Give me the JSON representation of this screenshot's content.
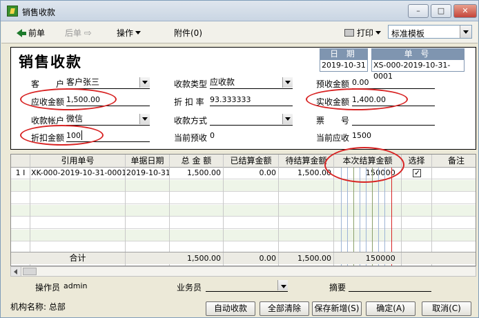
{
  "window": {
    "title": "销售收款"
  },
  "toolbar": {
    "prev": "前单",
    "next": "后单",
    "ops": "操作",
    "attach": "附件(0)",
    "print": "打印",
    "template_value": "标准模板"
  },
  "form": {
    "title": "销售收款",
    "date_label": "日 期",
    "date_value": "2019-10-31",
    "no_label": "单 号",
    "no_value": "XS-000-2019-10-31-0001",
    "customer_label": "客　　户",
    "customer_value": "客户张三",
    "receivable_label": "应收金额",
    "receivable_value": "1,500.00",
    "account_label": "收款帐户",
    "account_value": "微信",
    "discount_amt_label": "折扣金额",
    "discount_amt_value": "100",
    "collect_type_label": "收款类型",
    "collect_type_value": "应收款",
    "discount_rate_label": "折 扣 率",
    "discount_rate_value": "93.333333",
    "collect_method_label": "收款方式",
    "collect_method_value": "",
    "cur_prepaid_label": "当前预收",
    "cur_prepaid_value": "0",
    "prepaid_label": "预收金额",
    "prepaid_value": "0.00",
    "actual_label": "实收金额",
    "actual_value": "1,400.00",
    "ticket_label": "票　　号",
    "ticket_value": "",
    "cur_receivable_label": "当前应收",
    "cur_receivable_value": "1500"
  },
  "grid": {
    "columns": [
      "引用单号",
      "单据日期",
      "总 金 额",
      "已结算金额",
      "待结算金额",
      "本次结算金额",
      "选择",
      "备注"
    ],
    "rows": [
      {
        "idx": "1",
        "marker": "I",
        "ref": "XK-000-2019-10-31-0001",
        "date": "2019-10-31",
        "total": "1,500.00",
        "settled": "0.00",
        "pending": "1,500.00",
        "this_time": "150000",
        "checked": true,
        "remark": ""
      }
    ],
    "total_label": "合计",
    "total_total": "1,500.00",
    "total_settled": "0.00",
    "total_pending": "1,500.00",
    "total_this_time": "150000"
  },
  "bottom": {
    "operator_label": "操作员",
    "operator_value": "admin",
    "salesman_label": "业务员",
    "summary_label": "摘要",
    "org_label": "机构名称:",
    "org_value": "总部",
    "btn_auto": "自动收款",
    "btn_clear": "全部清除",
    "btn_save_new": "保存新增(S)",
    "btn_ok": "确定(A)",
    "btn_cancel": "取消(C)"
  }
}
